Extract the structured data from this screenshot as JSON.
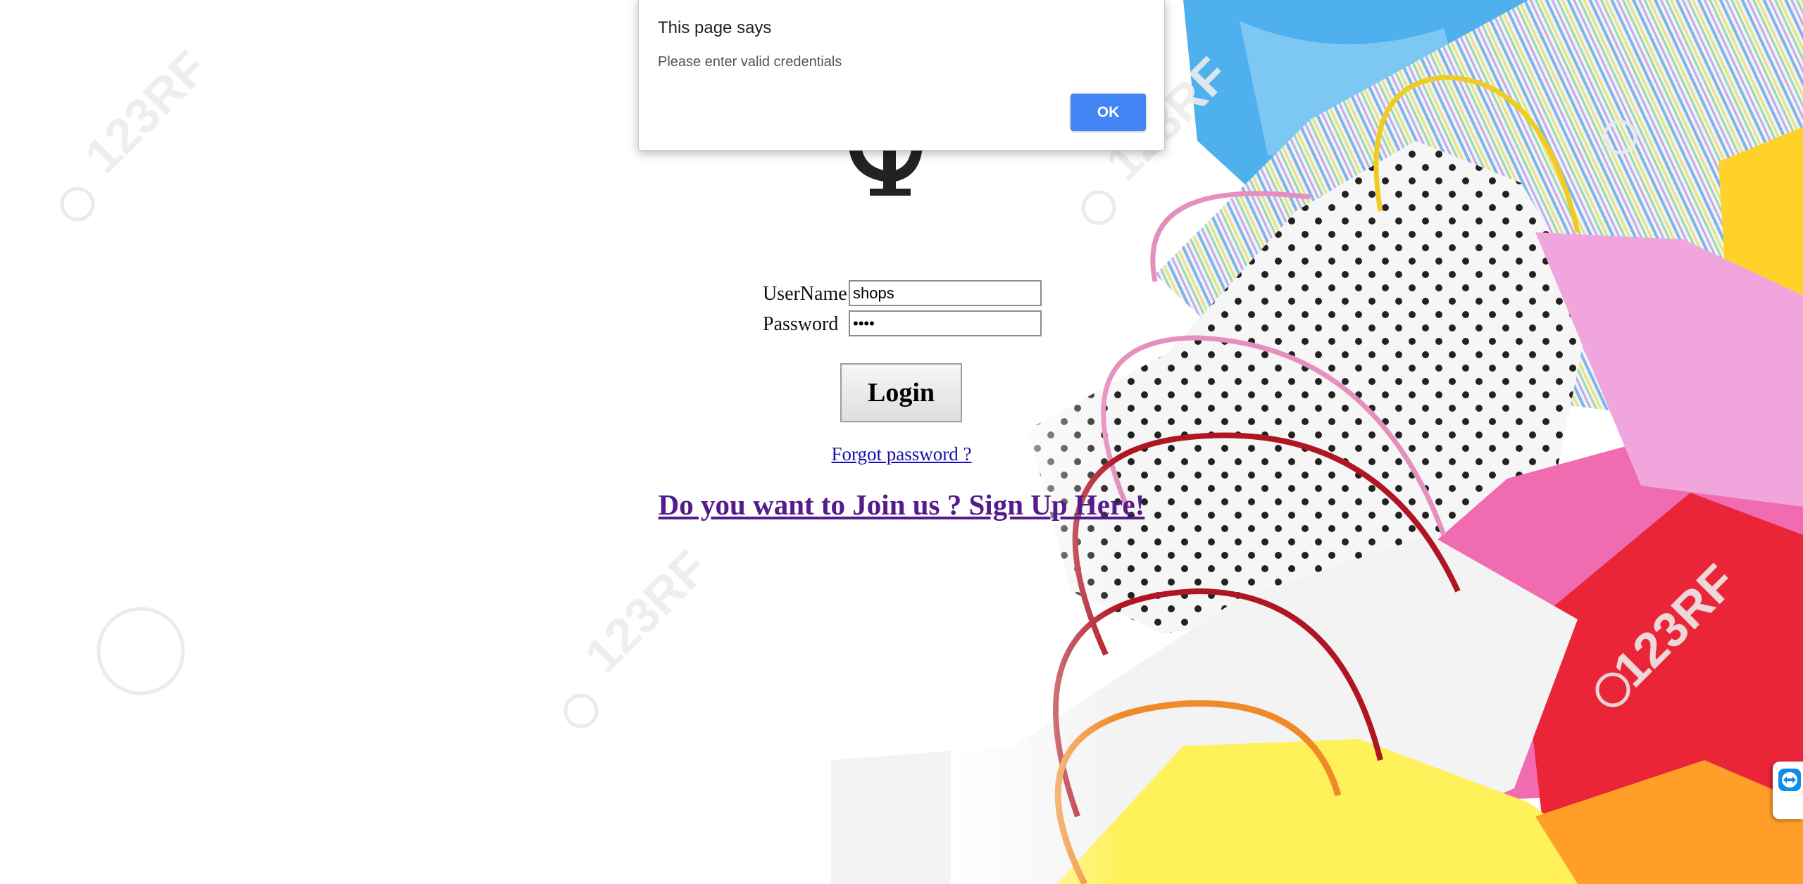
{
  "form": {
    "username_label": "UserName",
    "username_value": "shops",
    "password_label": "Password",
    "password_value": "••••",
    "login_label": "Login"
  },
  "links": {
    "forgot": "Forgot password ?",
    "signup": "Do you want to Join us ? Sign Up Here!"
  },
  "dialog": {
    "title": "This page says",
    "message": "Please enter valid credentials",
    "ok_label": "OK"
  },
  "watermark": "123RF",
  "icons": {
    "side_tab": "teamviewer-icon"
  },
  "colors": {
    "ok_button": "#4285f4",
    "link": "#1a0dab",
    "visited_link": "#551a8b"
  }
}
